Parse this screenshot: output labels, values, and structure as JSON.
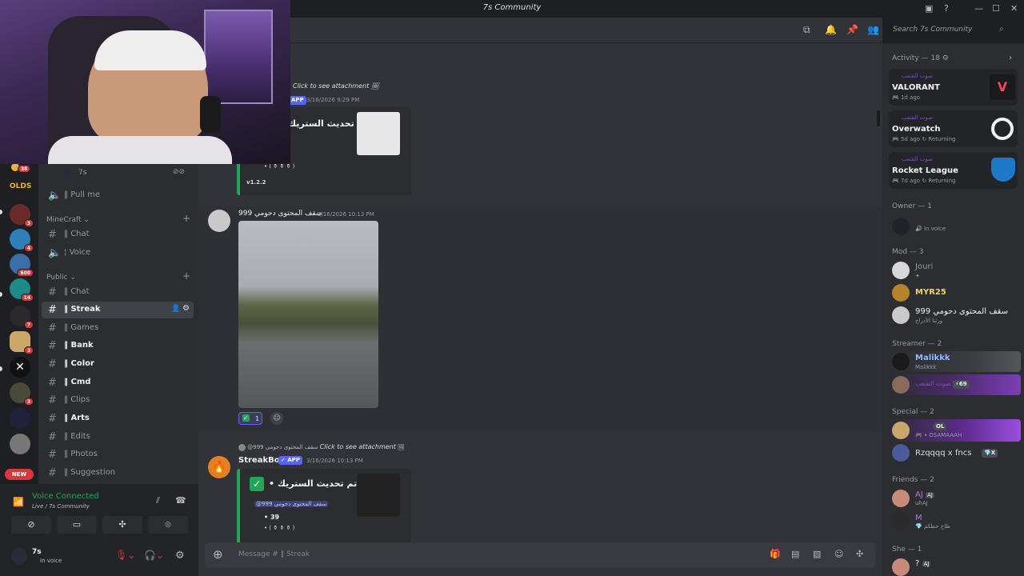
{
  "window": {
    "title": "7s Community"
  },
  "search": {
    "placeholder": "Search 7s Community"
  },
  "rail": {
    "badges": [
      "38",
      "3",
      "4",
      "600",
      "14",
      "7",
      "3",
      "3"
    ],
    "olds_label": "OLDS",
    "new_label": "NEW"
  },
  "sidebar": {
    "voice_user": "7s",
    "pull_me": "Pull me",
    "categories": [
      {
        "name": "MineCraft",
        "channels": [
          {
            "label": "Chat"
          },
          {
            "label": "Voice"
          }
        ]
      },
      {
        "name": "Public",
        "channels": [
          {
            "label": "Chat"
          },
          {
            "label": "Streak"
          },
          {
            "label": "Games"
          },
          {
            "label": "Bank"
          },
          {
            "label": "Color"
          },
          {
            "label": "Cmd"
          },
          {
            "label": "Clips"
          },
          {
            "label": "Arts"
          },
          {
            "label": "Edits"
          },
          {
            "label": "Photos"
          },
          {
            "label": "Suggestion"
          }
        ]
      }
    ]
  },
  "voice_panel": {
    "status": "Voice Connected",
    "channel": "Live / 7s Community",
    "username": "7s",
    "user_status": "In voice"
  },
  "messages": [
    {
      "reply_hint": "Click to see attachment",
      "app_badge": "APP",
      "timestamp": "3/16/2026 9:29 PM",
      "embed_title": "تم تحديث الستريك",
      "embed_line": "• ( ⚱ ⚱ ⚱ )",
      "version": "v1.2.2"
    },
    {
      "author": "999 سقف المحتوى دحومي",
      "timestamp": "3/16/2026 10:13 PM",
      "reaction_count": "1"
    },
    {
      "reply_author": "@999 سقف المحتوى دحومي",
      "reply_hint": "Click to see attachment",
      "author": "StreakBot",
      "app_badge": "APP",
      "timestamp": "3/16/2026 10:13 PM",
      "embed_title": "تم تحديث الستريك •",
      "mention": "@سقف المحتوى دحومي 999",
      "streak": "39",
      "embed_line": "• ( ⚱ ⚱ ⚱ )"
    }
  ],
  "composer": {
    "placeholder": "Message # ‖ Streak"
  },
  "members": {
    "activity_header": "Activity — 18",
    "activity": [
      {
        "user": "صوت الشعب",
        "game": "VALORANT",
        "meta": "1d ago"
      },
      {
        "user": "صوت الشعب",
        "game": "Overwatch",
        "meta": "5d ago",
        "extra": "Returning"
      },
      {
        "user": "صوت الشعب",
        "game": "Rocket League",
        "meta": "7d ago",
        "extra": "Returning"
      }
    ],
    "sections": [
      {
        "title": "Owner — 1",
        "members": [
          {
            "name": "",
            "sub": "In voice"
          }
        ]
      },
      {
        "title": "Mod — 3",
        "members": [
          {
            "name": "Jouri",
            "sub": "✦"
          },
          {
            "name": "MYR25",
            "sub": ""
          },
          {
            "name": "999 سقف المحتوى دحومي",
            "sub": "ورثنا الأدراج"
          }
        ]
      },
      {
        "title": "Streamer — 2",
        "members": [
          {
            "name": "Malikkk",
            "sub": "Malikkk"
          },
          {
            "name": "صوت الشعب",
            "sub": "69"
          }
        ]
      },
      {
        "title": "Special — 2",
        "members": [
          {
            "name": "OL",
            "sub": "OSAMAAAH"
          },
          {
            "name": "Rzqqqq x fncs",
            "sub": "X"
          }
        ]
      },
      {
        "title": "Friends — 2",
        "members": [
          {
            "name": "AJ",
            "sub": "uhAJ"
          },
          {
            "name": "M",
            "sub": "طاح حظكم"
          }
        ]
      },
      {
        "title": "She — 1",
        "members": [
          {
            "name": "AJ",
            "sub": ""
          }
        ]
      }
    ]
  },
  "colors": {
    "accent": "#5865f2",
    "online": "#23a55a",
    "danger": "#da373c",
    "bg": "#313338"
  }
}
